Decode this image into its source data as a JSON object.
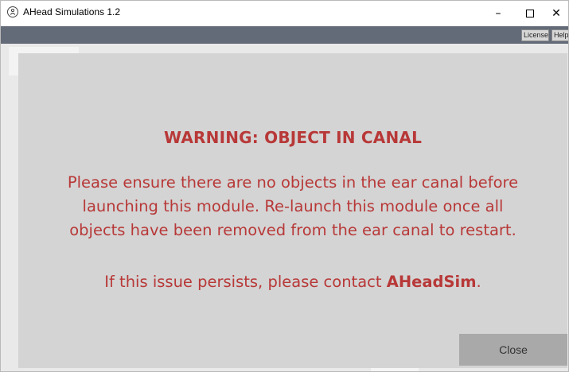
{
  "window": {
    "title": "AHead Simulations 1.2",
    "controls": {
      "minimize": "–",
      "close": "✕"
    }
  },
  "menubar": {
    "license_label": "License",
    "help_label": "Help"
  },
  "modal": {
    "heading": "WARNING: OBJECT IN CANAL",
    "body_lines": [
      "Please ensure there are no objects in the ear canal before",
      "launching this module. Re-launch this module once all",
      "objects have been removed from the ear canal to restart."
    ],
    "contact_prefix": "If this issue persists, please contact ",
    "contact_name": "AHeadSim",
    "contact_suffix": ".",
    "close_label": "Close"
  },
  "colors": {
    "warning_text": "#b83838",
    "menubar_bg": "#636b78",
    "modal_bg": "#d4d4d4",
    "close_button_bg": "#a9a9a9"
  },
  "icons": {
    "app_icon": "app-logo-icon",
    "minimize": "minimize-icon",
    "maximize": "maximize-icon",
    "close": "close-icon"
  }
}
